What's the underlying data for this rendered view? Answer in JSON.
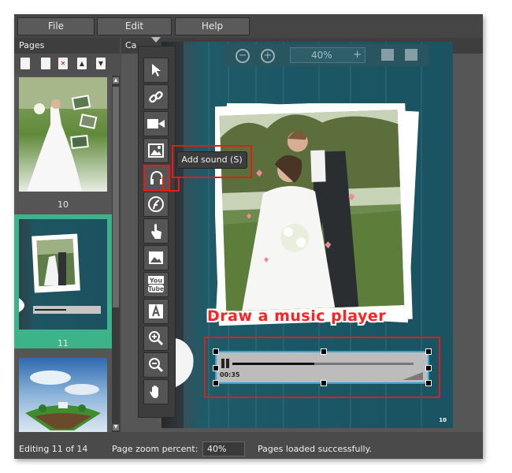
{
  "menu": {
    "file": "File",
    "edit": "Edit",
    "help": "Help"
  },
  "panels": {
    "pages_title": "Pages",
    "canvas_title": "Ca"
  },
  "thumbnails": [
    {
      "label": "10"
    },
    {
      "label": "11"
    }
  ],
  "zoom_control": {
    "value": "40%",
    "plus": "+"
  },
  "tooltip": {
    "text": "Add sound (S)"
  },
  "annotation": {
    "text": "Draw a music player"
  },
  "player": {
    "time": "00:35"
  },
  "page_number": "10",
  "status": {
    "editing": "Editing 11 of 14",
    "zoom_label": "Page zoom percent:",
    "zoom_value": "40%",
    "message": "Pages loaded successfully."
  },
  "colors": {
    "accent": "#3db38a",
    "highlight": "#e21b1b",
    "selection": "#2aa7e0"
  }
}
